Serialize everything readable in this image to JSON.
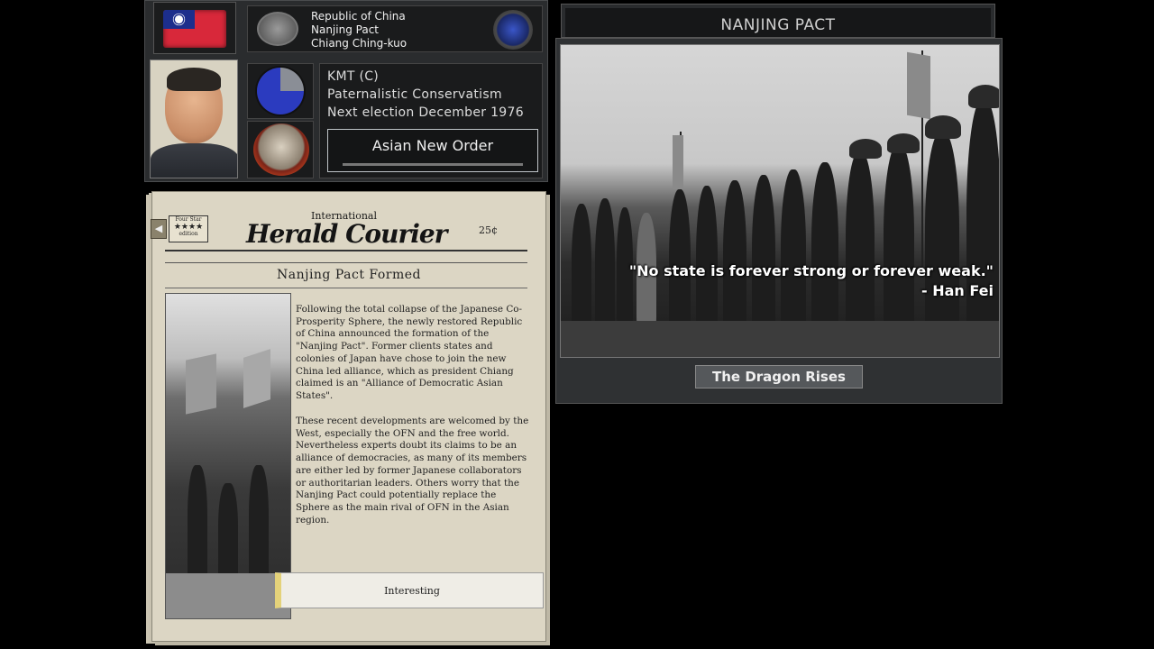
{
  "country": {
    "name": "Republic of China",
    "faction": "Nanjing Pact",
    "leader": "Chiang Ching-kuo",
    "flag_colors": {
      "field": "#d8283a",
      "canton": "#1c2e8c",
      "sun": "#ffffff"
    }
  },
  "politics": {
    "party": "KMT (C)",
    "ideology": "Paternalistic Conservatism",
    "election": "Next election December 1976",
    "ideology_button": "Asian New Order",
    "popularity_pie_colors": [
      "#2b3bbf",
      "#8a8e96"
    ]
  },
  "newspaper": {
    "edition_line1": "Four Star",
    "edition_stars": "★★★★",
    "edition_line2": "edition",
    "masthead_sup": "International",
    "masthead": "Herald Courier",
    "price": "25¢",
    "headline": "Nanjing Pact Formed",
    "paragraph1": "Following the total collapse of the Japanese Co-Prosperity Sphere, the newly restored Republic of China announced the formation of the \"Nanjing Pact\". Former clients states and colonies of Japan have chose to join the new China led alliance, which as president Chiang claimed is an \"Alliance of Democratic Asian States\".",
    "paragraph2": "These recent developments are welcomed by the West, especially the OFN and the free world. Nevertheless experts doubt its claims to be an alliance of democracies, as many of its members are either led by former Japanese collaborators or authoritarian leaders. Others worry that the Nanjing Pact could potentially replace the Sphere as the main rival of OFN in the Asian region.",
    "button": "Interesting"
  },
  "event": {
    "title": "NANJING PACT",
    "quote_line1": "\"No state is forever strong or forever weak.\"",
    "quote_line2": "- Han Fei",
    "option": "The Dragon Rises"
  }
}
